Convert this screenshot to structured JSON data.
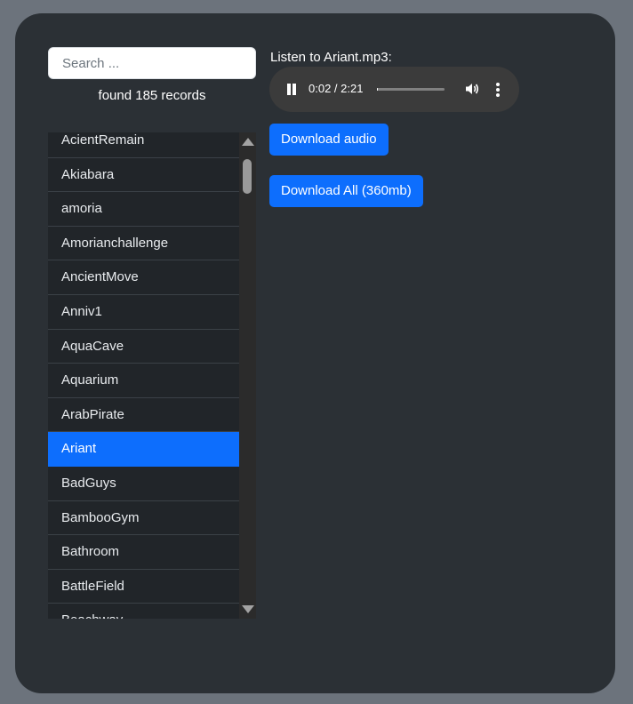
{
  "search": {
    "placeholder": "Search ...",
    "value": ""
  },
  "found_text": "found 185 records",
  "records": [
    "AcientRemain",
    "Akiabara",
    "amoria",
    "Amorianchallenge",
    "AncientMove",
    "Anniv1",
    "AquaCave",
    "Aquarium",
    "ArabPirate",
    "Ariant",
    "BadGuys",
    "BambooGym",
    "Bathroom",
    "BattleField",
    "Beachway"
  ],
  "selected_record": "Ariant",
  "player": {
    "label": "Listen to Ariant.mp3:",
    "time": "0:02 / 2:21",
    "progress": 0.014
  },
  "buttons": {
    "download_audio": "Download audio",
    "download_all": "Download All (360mb)"
  },
  "colors": {
    "accent": "#0d6efd",
    "card_bg": "#2b3035",
    "page_bg": "#6c737c"
  },
  "icons": {
    "play_state": "pause-icon",
    "volume": "volume-icon",
    "menu": "more-vertical-icon"
  }
}
